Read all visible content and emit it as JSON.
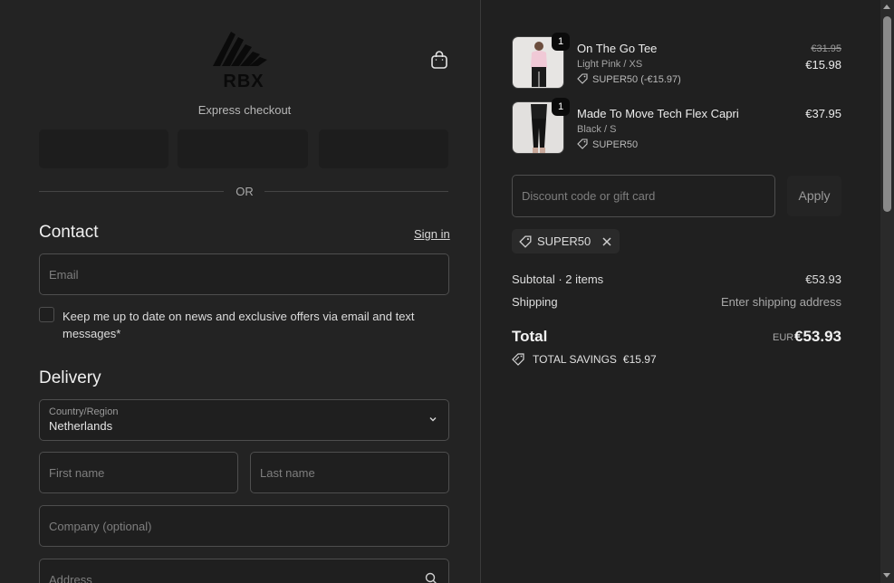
{
  "header": {
    "logo_text": "RBX",
    "express_checkout": "Express checkout",
    "or": "OR"
  },
  "contact": {
    "title": "Contact",
    "sign_in": "Sign in",
    "email_placeholder": "Email",
    "newsletter_label": "Keep me up to date on news and exclusive offers via email and text messages*"
  },
  "delivery": {
    "title": "Delivery",
    "country_label": "Country/Region",
    "country_value": "Netherlands",
    "first_name_placeholder": "First name",
    "last_name_placeholder": "Last name",
    "company_placeholder": "Company (optional)",
    "address_placeholder": "Address"
  },
  "cart": {
    "items": [
      {
        "quantity": "1",
        "name": "On The Go Tee",
        "variant": "Light Pink / XS",
        "discount": "SUPER50 (-€15.97)",
        "original_price": "€31.95",
        "price": "€15.98"
      },
      {
        "quantity": "1",
        "name": "Made To Move Tech Flex Capri",
        "variant": "Black / S",
        "discount": "SUPER50",
        "price": "€37.95"
      }
    ],
    "discount_placeholder": "Discount code or gift card",
    "apply_label": "Apply",
    "applied_code": "SUPER50",
    "subtotal_label": "Subtotal · 2 items",
    "subtotal_value": "€53.93",
    "shipping_label": "Shipping",
    "shipping_value": "Enter shipping address",
    "total_label": "Total",
    "total_currency": "EUR",
    "total_value": "€53.93",
    "savings_label": "TOTAL SAVINGS",
    "savings_value": "€15.97"
  },
  "colors": {
    "background": "#232323",
    "summary_background": "#202020",
    "field_border": "#4e4e4e"
  }
}
